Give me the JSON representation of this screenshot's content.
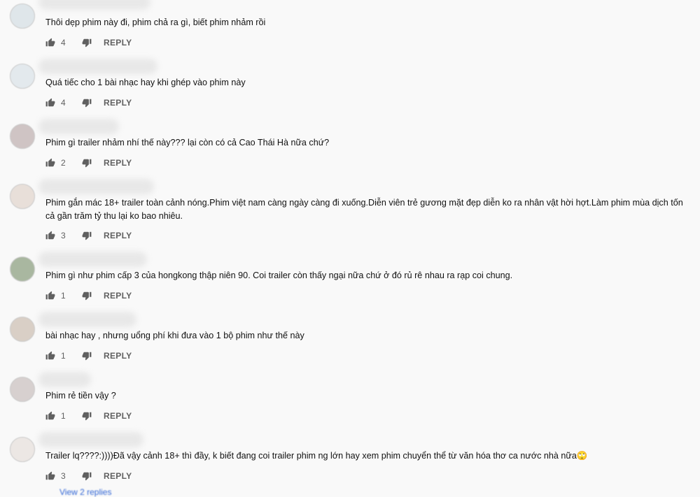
{
  "comments": [
    {
      "text": "Thôi dẹp phim này đi, phim chả ra gì, biết phim nhảm rồi",
      "likes": "4",
      "reply": "REPLY",
      "avatar_color": "#dfe6ea"
    },
    {
      "text": "Quá tiếc cho 1 bài nhạc hay khi ghép vào phim này",
      "likes": "4",
      "reply": "REPLY",
      "avatar_color": "#e3e9ed"
    },
    {
      "text": "Phim gì trailer nhảm nhí thế này??? lại còn có cả Cao Thái Hà nữa chứ?",
      "likes": "2",
      "reply": "REPLY",
      "avatar_color": "#cfc4c4"
    },
    {
      "text": "Phim gắn mác 18+ trailer toàn cảnh nóng.Phim việt nam càng ngày càng đi xuống.Diễn viên trẻ gương mặt đẹp diễn ko ra nhân vật hời hợt.Làm phim mùa dịch tốn cả gần trăm tỷ thu lại ko bao nhiêu.",
      "likes": "3",
      "reply": "REPLY",
      "avatar_color": "#e8dfd9"
    },
    {
      "text": "Phim gì như phim cấp 3 của hongkong thập niên 90. Coi trailer còn thấy ngại nữa chứ ở đó rủ rê nhau ra rạp coi chung.",
      "likes": "1",
      "reply": "REPLY",
      "avatar_color": "#a9b7a0"
    },
    {
      "text": "bài nhạc hay , nhưng uổng phí khi đưa vào 1 bộ phim như thế này",
      "likes": "1",
      "reply": "REPLY",
      "avatar_color": "#d9cfc6"
    },
    {
      "text": "Phim rẻ tiền vậy ?",
      "likes": "1",
      "reply": "REPLY",
      "avatar_color": "#d7d0cf"
    },
    {
      "text": "Trailer lq????:))))Đã vậy cảnh 18+ thì đầy, k biết đang coi trailer phim ng lớn hay xem phim chuyển thể từ văn hóa thơ ca nước nhà nữa🙄",
      "likes": "3",
      "reply": "REPLY",
      "avatar_color": "#ece7e4"
    }
  ],
  "view_replies": "View 2 replies",
  "colors": {
    "background": "#f9f9f9",
    "meta_text": "#606060",
    "link": "#3367d6"
  },
  "icons": {
    "like": "thumbs-up-icon",
    "dislike": "thumbs-down-icon"
  }
}
